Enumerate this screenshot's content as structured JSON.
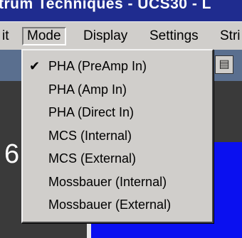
{
  "window": {
    "title": "trum Techniques - UCS30 - L"
  },
  "menubar": {
    "items": [
      "it",
      "Mode",
      "Display",
      "Settings",
      "Stri"
    ]
  },
  "toolbar": {
    "icon": "document-icon"
  },
  "workarea": {
    "glyph": "6"
  },
  "mode_menu": {
    "items": [
      {
        "label": "PHA (PreAmp In)",
        "checked": true
      },
      {
        "label": "PHA (Amp In)",
        "checked": false
      },
      {
        "label": "PHA (Direct In)",
        "checked": false
      },
      {
        "label": "MCS (Internal)",
        "checked": false
      },
      {
        "label": "MCS (External)",
        "checked": false
      },
      {
        "label": "Mossbauer (Internal)",
        "checked": false
      },
      {
        "label": "Mossbauer (External)",
        "checked": false
      }
    ],
    "check_glyph": "✔"
  },
  "colors": {
    "titlebar": "#1f2c8f",
    "menu_bg": "#d0cecb",
    "toolbar": "#5a6f8f",
    "workarea": "#3a3a3a",
    "blue_panel": "#0a10f0"
  }
}
